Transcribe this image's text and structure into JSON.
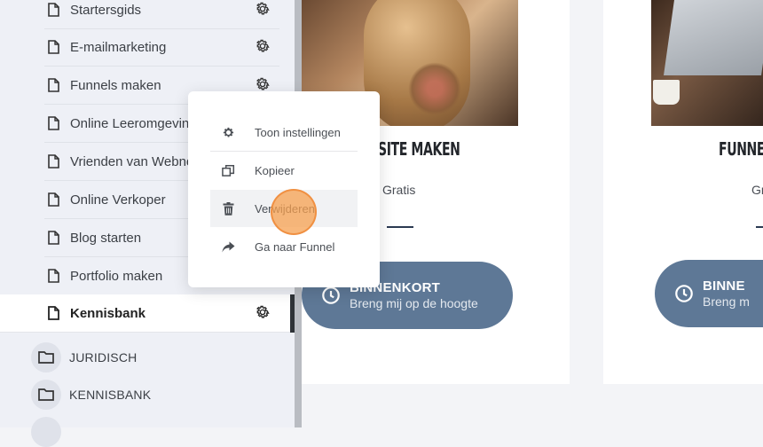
{
  "sidebar": {
    "items": [
      {
        "label": "Startersgids"
      },
      {
        "label": "E-mailmarketing"
      },
      {
        "label": "Funnels maken"
      },
      {
        "label": "Online Leeromgeving"
      },
      {
        "label": "Vrienden van Webnemo"
      },
      {
        "label": "Online Verkoper"
      },
      {
        "label": "Blog starten"
      },
      {
        "label": "Portfolio maken"
      },
      {
        "label": "Kennisbank"
      }
    ],
    "folders": [
      {
        "label": "JURIDISCH"
      },
      {
        "label": "KENNISBANK"
      }
    ]
  },
  "context_menu": {
    "items": [
      {
        "label": "Toon instellingen",
        "icon": "gear-icon"
      },
      {
        "label": "Kopieer",
        "icon": "copy-icon"
      },
      {
        "label": "Verwijderen",
        "icon": "trash-icon"
      },
      {
        "label": "Ga naar Funnel",
        "icon": "share-arrow-icon"
      }
    ]
  },
  "cards": [
    {
      "title": "SITE MAKEN",
      "price": "Gratis",
      "cta_title": "BINNENKORT",
      "cta_subtitle": "Breng mij op de hoogte"
    },
    {
      "title": "FUNNEL",
      "price": "Gr",
      "cta_title": "BINNE",
      "cta_subtitle": "Breng m"
    }
  ],
  "colors": {
    "accent": "#5e7896",
    "click_marker": "#f5a050"
  }
}
